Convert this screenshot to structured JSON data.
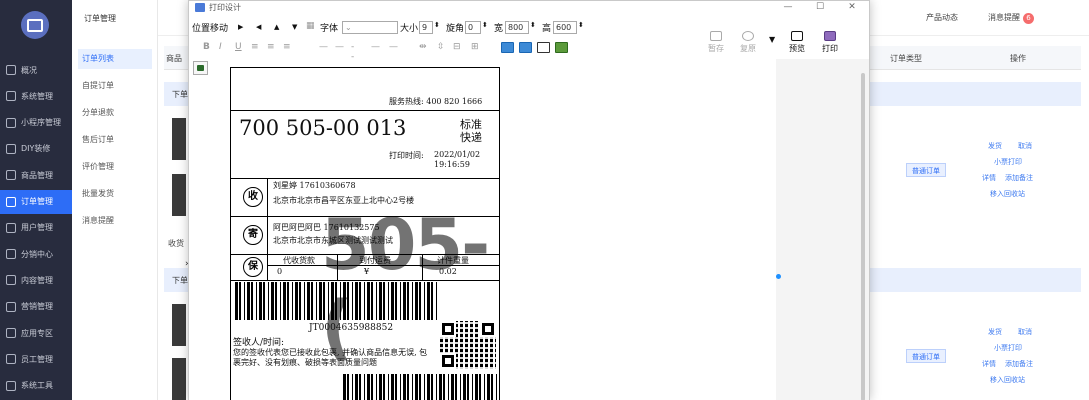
{
  "app": {
    "sidebar_items": [
      "概况",
      "系统管理",
      "小程序管理",
      "DIY装修",
      "商品管理",
      "订单管理",
      "用户管理",
      "分销中心",
      "内容管理",
      "营销管理",
      "应用专区",
      "员工管理",
      "系统工具"
    ],
    "subnav_title": "订单管理",
    "subnav_items": [
      "订单列表",
      "自提订单",
      "分单退款",
      "售后订单",
      "评价管理",
      "批量发货",
      "消息提醒"
    ],
    "topbar": {
      "product_news": "产品动态",
      "message_alert": "消息提醒",
      "message_count": "6"
    },
    "table_header": {
      "goods": "商品",
      "order_type": "订单类型",
      "action": "操作"
    },
    "group_label": "下单",
    "receiver_label": "收货",
    "order_tag": "普通订单",
    "row_actions": {
      "ship": "发货",
      "cancel": "取消",
      "mini_print": "小票打印",
      "detail": "详情",
      "add_note": "添加备注",
      "move_recycle": "移入回收站"
    }
  },
  "dialog": {
    "title": "打印设计",
    "win_controls": {
      "minimize": "—",
      "maximize": "☐",
      "close": "✕"
    },
    "toolbar": {
      "position_move": "位置移动",
      "font_label": "字体",
      "size_label": "大小",
      "size_value": "9",
      "rotate_label": "旋角",
      "rotate_value": "0",
      "width_label": "宽",
      "width_value": "800",
      "height_label": "高",
      "height_value": "600",
      "save_label": "暂存",
      "restore_label": "复原",
      "preview_label": "预览",
      "print_label": "打印"
    },
    "label": {
      "hotline_text": "服务热线: 400 820 1666",
      "tracking_number": "700 505-00 013",
      "service_type_1": "标准",
      "service_type_2": "快递",
      "print_time_label": "打印时间:",
      "print_date": "2022/01/02",
      "print_clock": "19:16:59",
      "receiver_icon": "收",
      "receiver_name_phone": "刘星婷 17610360678",
      "receiver_address": "北京市北京市昌平区东亚上北中心2号楼",
      "sender_icon": "寄",
      "sender_name_phone": "阿巴阿巴阿巴 17610132575",
      "sender_address": "北京市北京市东城区测试测试测试",
      "insured_icon": "保",
      "col_cod": "代收货款",
      "col_freight": "到付运费",
      "col_weight": "计件重量",
      "val_cod": "0",
      "val_freight": "¥",
      "val_weight": "0.02",
      "watermark": "505-(",
      "barcode_number": "JT0004635988852",
      "sign_label": "签收人/时间:",
      "sign_notice": "您的签收代表您已接收此包裹, 并确认商品信息无误, 包裹完好、没有划痕、破损等表面质量问题"
    }
  }
}
